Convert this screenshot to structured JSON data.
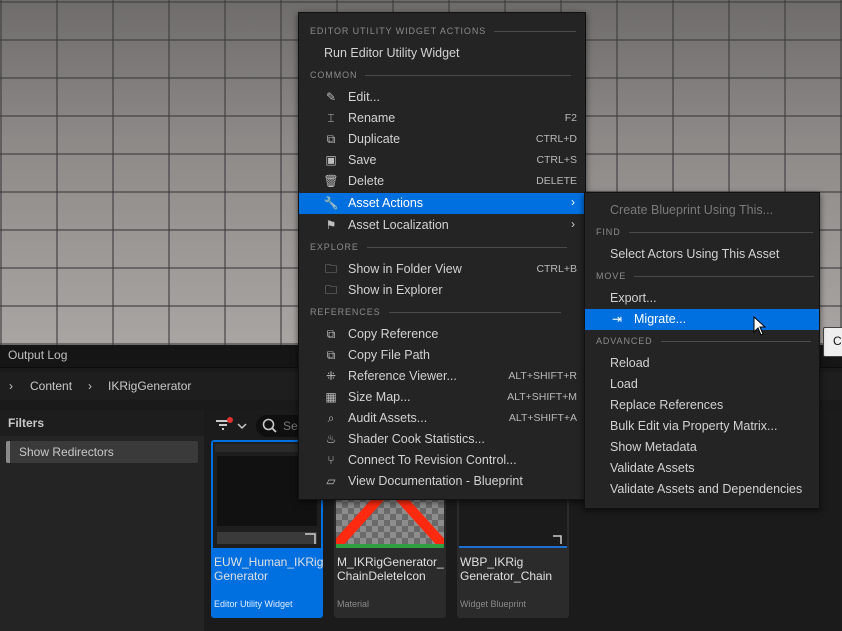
{
  "bottom_panel": {
    "tab": "Output Log",
    "breadcrumb": [
      "Content",
      "IKRigGenerator"
    ],
    "filters": {
      "title": "Filters",
      "item": "Show Redirectors"
    },
    "search_placeholder": "Se"
  },
  "tiles": [
    {
      "name": "EUW_Human_IKRig Generator",
      "type": "Editor Utility Widget",
      "selected": true
    },
    {
      "name": "M_IKRigGenerator_ ChainDeleteIcon",
      "type": "Material",
      "selected": false
    },
    {
      "name": "WBP_IKRig Generator_Chain",
      "type": "Widget Blueprint",
      "selected": false
    }
  ],
  "context_menu": {
    "sections": {
      "euw": "EDITOR UTILITY WIDGET ACTIONS",
      "common": "COMMON",
      "explore": "EXPLORE",
      "references": "REFERENCES"
    },
    "run_euw": "Run Editor Utility Widget",
    "items": {
      "edit": {
        "label": "Edit...",
        "icon": "pencil-icon"
      },
      "rename": {
        "label": "Rename",
        "shortcut": "F2",
        "icon": "rename-icon"
      },
      "duplicate": {
        "label": "Duplicate",
        "shortcut": "CTRL+D",
        "icon": "duplicate-icon"
      },
      "save": {
        "label": "Save",
        "shortcut": "CTRL+S",
        "icon": "save-icon"
      },
      "delete": {
        "label": "Delete",
        "shortcut": "DELETE",
        "icon": "trash-icon"
      },
      "asset_actions": {
        "label": "Asset Actions",
        "icon": "wrench-icon"
      },
      "asset_localization": {
        "label": "Asset Localization",
        "icon": "flag-icon"
      },
      "show_folder": {
        "label": "Show in Folder View",
        "shortcut": "CTRL+B",
        "icon": "folder-search-icon"
      },
      "show_explorer": {
        "label": "Show in Explorer",
        "icon": "folder-search-icon"
      },
      "copy_reference": {
        "label": "Copy Reference",
        "icon": "copy-icon"
      },
      "copy_path": {
        "label": "Copy File Path",
        "icon": "copy-icon"
      },
      "ref_viewer": {
        "label": "Reference Viewer...",
        "shortcut": "ALT+SHIFT+R",
        "icon": "graph-icon"
      },
      "size_map": {
        "label": "Size Map...",
        "shortcut": "ALT+SHIFT+M",
        "icon": "size-map-icon"
      },
      "audit": {
        "label": "Audit Assets...",
        "shortcut": "ALT+SHIFT+A",
        "icon": "magnifier-icon"
      },
      "shader_cook": {
        "label": "Shader Cook Statistics...",
        "icon": "chef-hat-icon"
      },
      "revision": {
        "label": "Connect To Revision Control...",
        "icon": "branch-icon"
      },
      "documentation": {
        "label": "View Documentation - Blueprint",
        "icon": "book-icon"
      }
    }
  },
  "submenu": {
    "create_bp": "Create Blueprint Using This...",
    "sections": {
      "find": "FIND",
      "move": "MOVE",
      "advanced": "ADVANCED"
    },
    "items": {
      "select_actors": "Select Actors Using This Asset",
      "export": "Export...",
      "migrate": "Migrate...",
      "reload": "Reload",
      "load": "Load",
      "replace_refs": "Replace References",
      "bulk_edit": "Bulk Edit via Property Matrix...",
      "show_metadata": "Show Metadata",
      "validate": "Validate Assets",
      "validate_deps": "Validate Assets and Dependencies"
    }
  },
  "tooltip_fragment": "C",
  "colors": {
    "highlight": "#0070e0",
    "menu_bg": "#242424"
  }
}
